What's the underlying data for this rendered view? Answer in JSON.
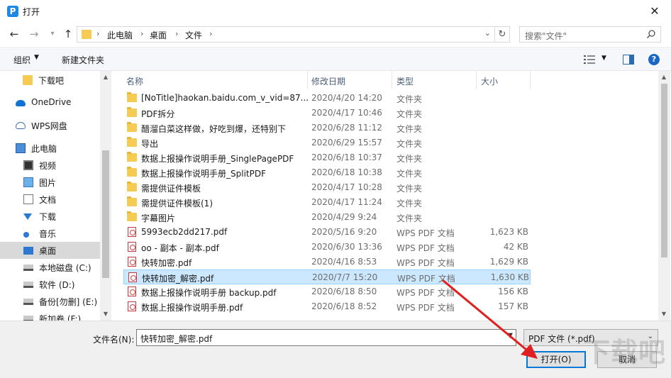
{
  "window": {
    "title": "打开",
    "app_icon_letter": "P",
    "close_glyph": "✕"
  },
  "address": {
    "crumbs": [
      "此电脑",
      "桌面",
      "文件"
    ],
    "separator": "›",
    "search_placeholder": "搜索\"文件\""
  },
  "toolbar": {
    "organize": "组织",
    "new_folder": "新建文件夹",
    "help": "?"
  },
  "nav_items": [
    {
      "label": "下载吧",
      "icon": "folder-icon"
    },
    {
      "label": "OneDrive",
      "icon": "cloud-icon"
    },
    {
      "label": "WPS网盘",
      "icon": "cloud-outline-icon"
    },
    {
      "label": "此电脑",
      "icon": "computer-icon"
    },
    {
      "label": "视频",
      "icon": "video-icon"
    },
    {
      "label": "图片",
      "icon": "picture-icon"
    },
    {
      "label": "文档",
      "icon": "document-icon"
    },
    {
      "label": "下载",
      "icon": "download-icon"
    },
    {
      "label": "音乐",
      "icon": "music-icon"
    },
    {
      "label": "桌面",
      "icon": "desktop-icon",
      "selected": true
    },
    {
      "label": "本地磁盘 (C:)",
      "icon": "drive-icon"
    },
    {
      "label": "软件 (D:)",
      "icon": "drive-icon"
    },
    {
      "label": "备份[勿删] (E:)",
      "icon": "drive-icon"
    },
    {
      "label": "新加卷 (F:)",
      "icon": "drive-icon"
    }
  ],
  "columns": {
    "name": "名称",
    "date": "修改日期",
    "type": "类型",
    "size": "大小"
  },
  "files": [
    {
      "name": "[NoTitle]haokan.baidu.com_v_vid=87...",
      "date": "2020/4/20 14:20",
      "type": "文件夹",
      "size": "",
      "kind": "folder"
    },
    {
      "name": "PDF拆分",
      "date": "2020/4/17 10:46",
      "type": "文件夹",
      "size": "",
      "kind": "folder"
    },
    {
      "name": "醋溜白菜这样做，好吃到爆，还特别下",
      "date": "2020/6/28 11:12",
      "type": "文件夹",
      "size": "",
      "kind": "folder"
    },
    {
      "name": "导出",
      "date": "2020/6/29 15:57",
      "type": "文件夹",
      "size": "",
      "kind": "folder"
    },
    {
      "name": "数据上报操作说明手册_SinglePagePDF",
      "date": "2020/6/18 10:37",
      "type": "文件夹",
      "size": "",
      "kind": "folder"
    },
    {
      "name": "数据上报操作说明手册_SplitPDF",
      "date": "2020/6/18 10:38",
      "type": "文件夹",
      "size": "",
      "kind": "folder"
    },
    {
      "name": "需提供证件模板",
      "date": "2020/4/17 10:28",
      "type": "文件夹",
      "size": "",
      "kind": "folder"
    },
    {
      "name": "需提供证件模板(1)",
      "date": "2020/4/17 11:24",
      "type": "文件夹",
      "size": "",
      "kind": "folder"
    },
    {
      "name": "字幕图片",
      "date": "2020/4/29 9:24",
      "type": "文件夹",
      "size": "",
      "kind": "folder"
    },
    {
      "name": "5993ecb2dd217.pdf",
      "date": "2020/5/16 9:20",
      "type": "WPS PDF 文档",
      "size": "1,623 KB",
      "kind": "pdf"
    },
    {
      "name": "oo - 副本 - 副本.pdf",
      "date": "2020/6/30 13:36",
      "type": "WPS PDF 文档",
      "size": "42 KB",
      "kind": "pdf"
    },
    {
      "name": "快转加密.pdf",
      "date": "2020/4/16 8:53",
      "type": "WPS PDF 文档",
      "size": "1,629 KB",
      "kind": "pdf"
    },
    {
      "name": "快转加密_解密.pdf",
      "date": "2020/7/7 15:20",
      "type": "WPS PDF 文档",
      "size": "1,630 KB",
      "kind": "pdf",
      "selected": true
    },
    {
      "name": "数据上报操作说明手册 backup.pdf",
      "date": "2020/6/18 8:50",
      "type": "WPS PDF 文档",
      "size": "156 KB",
      "kind": "pdf"
    },
    {
      "name": "数据上报操作说明手册.pdf",
      "date": "2020/6/18 8:52",
      "type": "WPS PDF 文档",
      "size": "157 KB",
      "kind": "pdf"
    }
  ],
  "footer": {
    "filename_label": "文件名(N):",
    "filename_value": "快转加密_解密.pdf",
    "filetype_value": "PDF 文件 (*.pdf)",
    "open_button": "打开(O)",
    "cancel_button": "取消"
  },
  "watermark": "下载吧",
  "colors": {
    "selection": "#cce8ff",
    "folder": "#f6cb54",
    "accent": "#0078d7",
    "annotation_arrow": "#e02020"
  }
}
